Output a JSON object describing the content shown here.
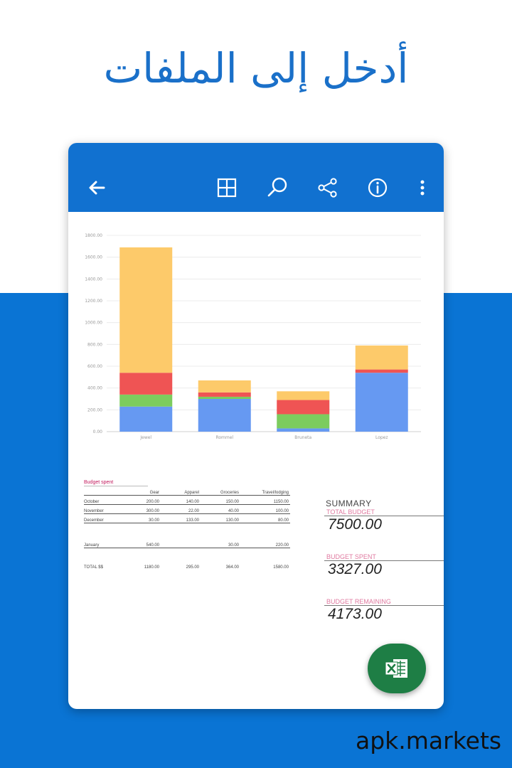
{
  "headline": "أدخل إلى الملفات",
  "watermark": "apk.markets",
  "toolbar": {
    "icons": [
      "back-arrow-icon",
      "grid-icon",
      "search-icon",
      "share-icon",
      "info-icon",
      "more-vertical-icon"
    ]
  },
  "colors": {
    "band": "#0a74d4",
    "appbar": "#1171d0",
    "fab": "#1e7e45",
    "series_blue": "#6699f2",
    "series_green": "#7ccc5e",
    "series_red": "#ef5454",
    "series_yellow": "#fdca6a"
  },
  "chart_data": {
    "type": "bar",
    "stacked": true,
    "categories": [
      "Jewel",
      "Rommel",
      "Bruneta",
      "Lopez"
    ],
    "series": [
      {
        "color": "#6699f2",
        "values": [
          230,
          300,
          30,
          540
        ]
      },
      {
        "color": "#7ccc5e",
        "values": [
          110,
          20,
          130,
          0
        ]
      },
      {
        "color": "#ef5454",
        "values": [
          200,
          40,
          130,
          30
        ]
      },
      {
        "color": "#fdca6a",
        "values": [
          1150,
          110,
          80,
          220
        ]
      }
    ],
    "yticks": [
      "0.00",
      "200.00",
      "400.00",
      "600.00",
      "800.00",
      "1000.00",
      "1200.00",
      "1400.00",
      "1600.00",
      "1800.00"
    ],
    "ylim": [
      0,
      1800
    ],
    "grid": true
  },
  "table": {
    "title": "Budget spent",
    "headers": [
      "",
      "Gear",
      "Apparel",
      "Groceries",
      "Travel/lodging"
    ],
    "rows": [
      [
        "October",
        "200.00",
        "140.00",
        "150.00",
        "1150.00"
      ],
      [
        "November",
        "300.00",
        "22.00",
        "40.00",
        "100.00"
      ],
      [
        "December",
        "30.00",
        "133.00",
        "130.00",
        "80.00"
      ]
    ],
    "rows2": [
      [
        "January",
        "540.00",
        "",
        "30.00",
        "220.00"
      ]
    ],
    "total": [
      "TOTAL $$",
      "1180.00",
      "295.00",
      "364.00",
      "1580.00"
    ]
  },
  "summary": {
    "title": "SUMMARY",
    "total_label": "TOTAL BUDGET",
    "total_value": "7500.00",
    "spent_label": "BUDGET SPENT",
    "spent_value": "3327.00",
    "remaining_label": "BUDGET REMAINING",
    "remaining_value": "4173.00"
  },
  "fab": {
    "icon": "excel-icon"
  }
}
